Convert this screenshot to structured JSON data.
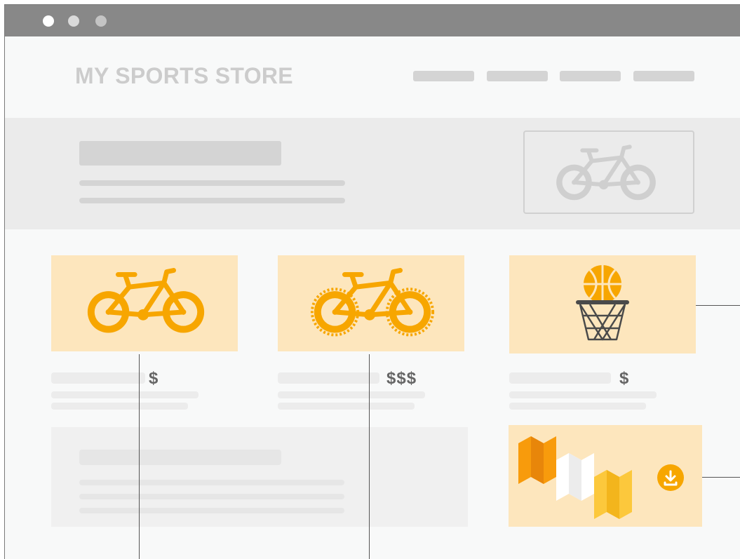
{
  "window": {
    "controls": [
      "close-dot",
      "minimize-dot",
      "maximize-dot"
    ],
    "control_colors": [
      "#ffffff",
      "#dadada",
      "#c4c4c4"
    ]
  },
  "header": {
    "brand": "MY SPORTS STORE",
    "nav_item_count": 4
  },
  "hero": {
    "image_icon": "bicycle-icon"
  },
  "products": [
    {
      "icon": "bicycle-icon",
      "price": "$"
    },
    {
      "icon": "mountain-bike-icon",
      "price": "$$$"
    },
    {
      "icon": "basketball-hoop-icon",
      "price": "$"
    }
  ],
  "map_card": {
    "icon": "folded-map-icon",
    "download_icon": "download-icon"
  },
  "colors": {
    "accent": "#f7a600",
    "card_bg": "#fde6bd",
    "map_dark": "#f89b0c",
    "map_light": "#ffffff",
    "map_yellow": "#fcc83c",
    "placeholder": "#d4d4d4",
    "titlebar": "#888888"
  }
}
